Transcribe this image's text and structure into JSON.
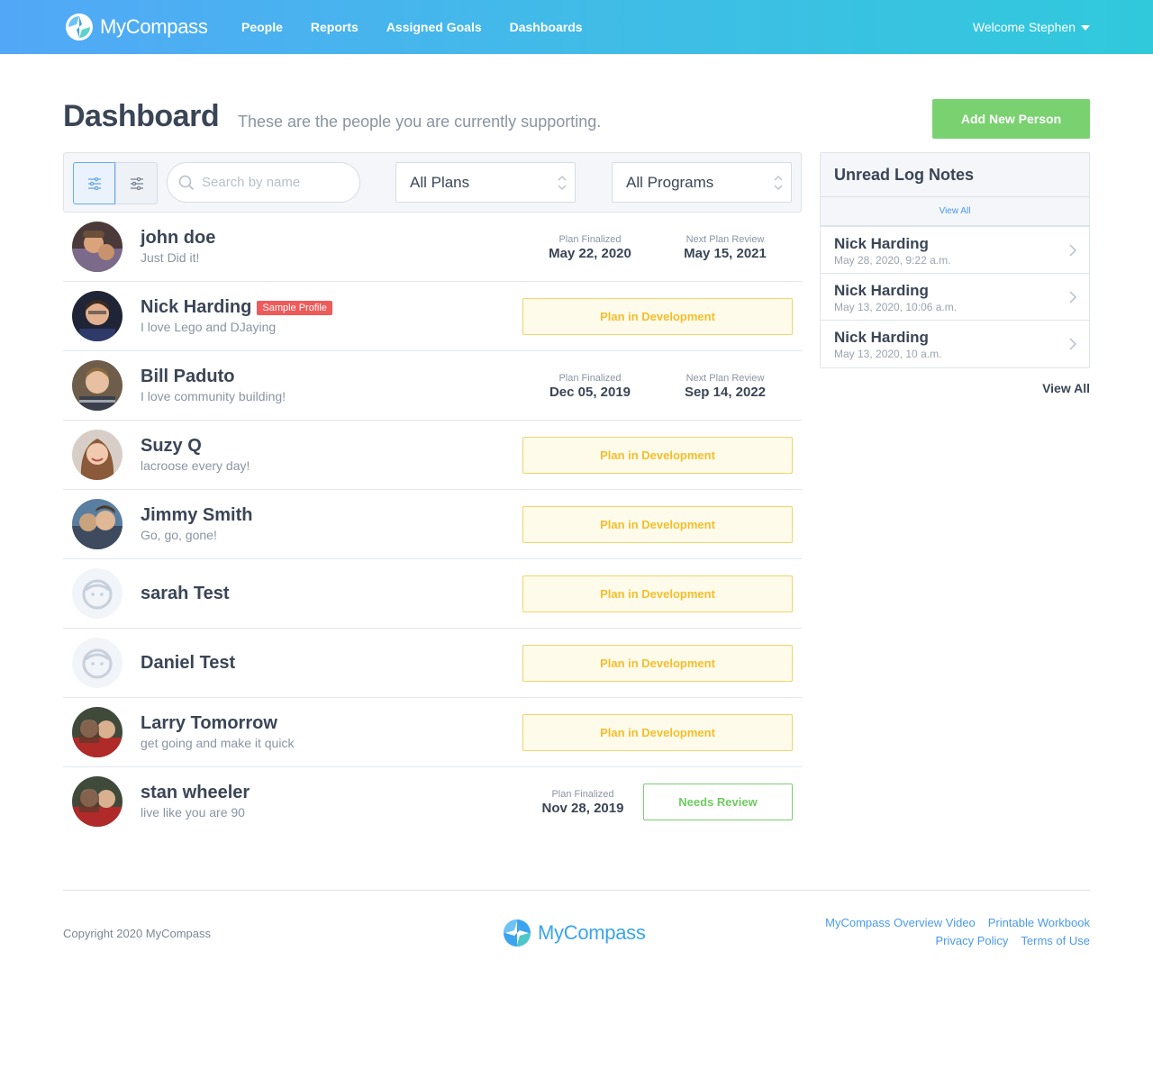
{
  "header": {
    "brand": "MyCompass",
    "nav": [
      "People",
      "Reports",
      "Assigned Goals",
      "Dashboards"
    ],
    "welcome": "Welcome Stephen",
    "colors": {
      "gradient_start": "#52a8f7",
      "gradient_end": "#30c9dc"
    }
  },
  "page": {
    "title": "Dashboard",
    "subtitle": "These are the people you are currently supporting.",
    "add_button": "Add New Person"
  },
  "filters": {
    "search_placeholder": "Search by name",
    "plans_select": "All Plans",
    "programs_select": "All Programs"
  },
  "people": [
    {
      "name": "john doe",
      "tagline": "Just Did it!",
      "plan_finalized_label": "Plan Finalized",
      "plan_finalized": "May 22, 2020",
      "next_review_label": "Next Plan Review",
      "next_review": "May 15, 2021"
    },
    {
      "name": "Nick Harding",
      "badge": "Sample Profile",
      "tagline": "I love Lego and DJaying",
      "status": "Plan in Development"
    },
    {
      "name": "Bill Paduto",
      "tagline": "I love community building!",
      "plan_finalized_label": "Plan Finalized",
      "plan_finalized": "Dec 05, 2019",
      "next_review_label": "Next Plan Review",
      "next_review": "Sep 14, 2022"
    },
    {
      "name": "Suzy Q",
      "tagline": "lacroose every day!",
      "status": "Plan in Development"
    },
    {
      "name": "Jimmy Smith",
      "tagline": "Go, go, gone!",
      "status": "Plan in Development"
    },
    {
      "name": "sarah Test",
      "status": "Plan in Development"
    },
    {
      "name": "Daniel Test",
      "status": "Plan in Development"
    },
    {
      "name": "Larry Tomorrow",
      "tagline": "get going and make it quick",
      "status": "Plan in Development"
    },
    {
      "name": "stan wheeler",
      "tagline": "live like you are 90",
      "plan_finalized_label": "Plan Finalized",
      "plan_finalized": "Nov 28, 2019",
      "status": "Needs Review"
    }
  ],
  "log_notes": {
    "title": "Unread Log Notes",
    "view_all_small": "View All",
    "items": [
      {
        "name": "Nick Harding",
        "time": "May 28, 2020, 9:22 a.m."
      },
      {
        "name": "Nick Harding",
        "time": "May 13, 2020, 10:06 a.m."
      },
      {
        "name": "Nick Harding",
        "time": "May 13, 2020, 10 a.m."
      }
    ],
    "view_all": "View All"
  },
  "footer": {
    "copyright": "Copyright 2020 MyCompass",
    "brand": "MyCompass",
    "links_row1": [
      "MyCompass Overview Video",
      "Printable Workbook"
    ],
    "links_row2": [
      "Privacy Policy",
      "Terms of Use"
    ]
  }
}
